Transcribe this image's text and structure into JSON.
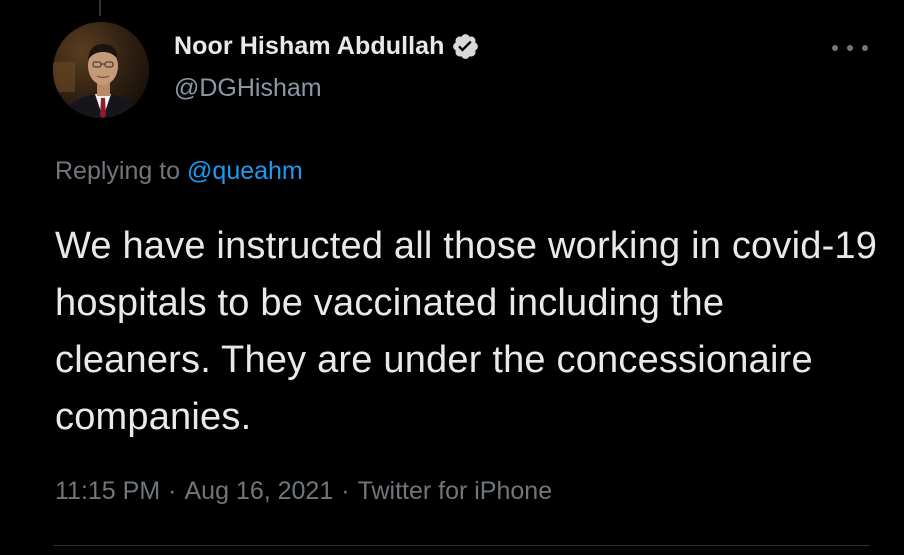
{
  "tweet": {
    "author": {
      "display_name": "Noor Hisham Abdullah",
      "handle": "@DGHisham",
      "verified": true,
      "avatar_icon": "profile-photo"
    },
    "replying_to": {
      "prefix": "Replying to",
      "handle": "@queahm"
    },
    "text": "We have instructed all those working in covid-19 hospitals to be vaccinated including the cleaners. They are under the concessionaire companies.",
    "time": "11:15 PM",
    "date": "Aug 16, 2021",
    "source": "Twitter for iPhone",
    "separator": "·"
  },
  "theme": {
    "background": "#000000",
    "text_primary": "#e7e9ea",
    "text_secondary": "#71767b",
    "link": "#1d9bf0",
    "divider": "#2f3336"
  },
  "icons": {
    "verified": "verified-badge-icon",
    "more": "more-options-icon"
  }
}
